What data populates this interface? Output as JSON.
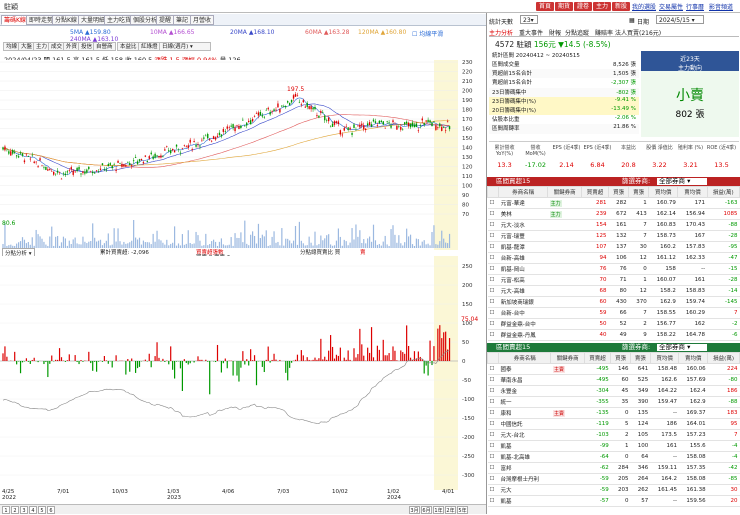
{
  "app": {
    "title": "駐穎"
  },
  "top_buttons": [
    "首頁",
    "期貨",
    "證卷",
    "主力",
    "新股"
  ],
  "top_links": [
    "我的選股",
    "交易屬性",
    "行事曆",
    "影音頻道"
  ],
  "tabs": [
    "籌碼K線",
    "即時走勢",
    "分點K線",
    "大量明細",
    "主力吃貨",
    "個股分析",
    "提醒",
    "筆記",
    "月營收"
  ],
  "subtabs": [
    "均線",
    "大盤",
    "主力",
    "成交",
    "外資",
    "投信",
    "自營商",
    "本益比",
    "紅綠燈",
    "日線(週月)"
  ],
  "ma_legend": [
    {
      "label": "5MA",
      "value": "159.80",
      "color": "#2a6bd6"
    },
    {
      "label": "10MA",
      "value": "166.65",
      "color": "#b34fd1"
    },
    {
      "label": "20MA",
      "value": "168.10",
      "color": "#3a49c9"
    },
    {
      "label": "60MA",
      "value": "163.28",
      "color": "#e05b5b"
    },
    {
      "label": "120MA",
      "value": "160.80",
      "color": "#e0a63a"
    },
    {
      "label": "240MA",
      "value": "163.10",
      "color": "#7a3bd6"
    }
  ],
  "ma_checkbox": "均線平滑",
  "quote_line": {
    "date": "2024/04/23",
    "items": [
      "開 161.5",
      "高 161.5",
      "低 158",
      "收 160.5"
    ],
    "change": "漲跌 1.5",
    "pct": "漲幅 0.94%",
    "volume": "量 126"
  },
  "price_axis": [
    "230",
    "220",
    "210",
    "200",
    "190",
    "180",
    "170",
    "160",
    "150",
    "140",
    "130",
    "120",
    "110",
    "100",
    "90",
    "80",
    "70"
  ],
  "price_marks": {
    "high": "197.5",
    "low": "80.6",
    "current": "156"
  },
  "vol_bar": {
    "label": "分點分析",
    "items": [
      "累計買賣超: -2,096",
      "買賣超張數",
      "分點總買賣比 買",
      "賣"
    ],
    "extra": "買賣 8  賣賣 6"
  },
  "osc_axis": [
    "250",
    "200",
    "150",
    "100",
    "50",
    "0",
    "-50",
    "-100",
    "-150",
    "-200",
    "-250",
    "-300"
  ],
  "osc_marker": "75.04",
  "x_axis": [
    {
      "label": "4/25",
      "sub": "2022"
    },
    {
      "label": "7/01",
      "sub": ""
    },
    {
      "label": "10/03",
      "sub": ""
    },
    {
      "label": "1/03",
      "sub": "2023"
    },
    {
      "label": "4/06",
      "sub": ""
    },
    {
      "label": "7/03",
      "sub": ""
    },
    {
      "label": "10/02",
      "sub": ""
    },
    {
      "label": "1/02",
      "sub": "2024"
    },
    {
      "label": "4/01",
      "sub": ""
    }
  ],
  "pager": [
    "1",
    "2",
    "3",
    "4",
    "5",
    "6"
  ],
  "range_buttons": [
    "3月",
    "6月",
    "1年",
    "2年",
    "5年"
  ],
  "right_header": {
    "days_label": "統計天數",
    "days_value": "23",
    "date_label": "日期",
    "date_value": "2024/5/15"
  },
  "right_tabs": [
    "主力分析",
    "重大事件",
    "財報",
    "分點追蹤",
    "賺賠率",
    "法人買賣(216元)"
  ],
  "stock": {
    "code": "4572 駐穎",
    "price": "156元",
    "change": "▼14.5",
    "pct": "(-8.5%)"
  },
  "period": {
    "label": "統計區間",
    "value": "20240412 ~ 20240515"
  },
  "stats": [
    {
      "label": "區間成交量",
      "value": "8,526 張"
    },
    {
      "label": "買超前15名合計",
      "value": "1,505 張"
    },
    {
      "label": "賣超前15名合計",
      "value": "-2,307 張"
    },
    {
      "label": "23日籌碼集中",
      "value": "-802 張"
    },
    {
      "label": "23日籌碼集中(%)",
      "value": "-9.41 %"
    },
    {
      "label": "20日籌碼集中(%)",
      "value": "-13.49 %"
    },
    {
      "label": "佔股本比重",
      "value": "-2.06 %"
    },
    {
      "label": "區間周轉率",
      "value": "21.86 %"
    }
  ],
  "main_force": {
    "title": "近23天",
    "subtitle": "主力動向",
    "verdict": "小賣",
    "amount": "802 張"
  },
  "metrics_head": [
    "累計營收 YoY(%)",
    "營收 MoM(%)",
    "EPS (近4季)",
    "EPS (近4季)",
    "本益比",
    "股價 淨值比",
    "殖利率 (%)",
    "ROE (近4季)"
  ],
  "metrics_vals": [
    "13.3",
    "-17.02",
    "2.14",
    "6.84",
    "20.8",
    "3.22",
    "3.21",
    "13.5"
  ],
  "buy_section": {
    "title": "區間買超15",
    "filter_label": "篩選券商:",
    "filter_value": "全部券商"
  },
  "buy_cols": [
    "券商名稱",
    "關鍵券商",
    "買賣超",
    "買張",
    "賣張",
    "買均價",
    "賣均價",
    "損益(萬)"
  ],
  "buy_rows": [
    [
      "元富-華達",
      "主力",
      "281",
      "282",
      "1",
      "160.79",
      "171",
      "-163"
    ],
    [
      "美林",
      "主力",
      "239",
      "672",
      "413",
      "162.14",
      "156.94",
      "1085"
    ],
    [
      "元大-淡水",
      "",
      "154",
      "161",
      "7",
      "160.83",
      "170.43",
      "-88"
    ],
    [
      "元富-瑞豐",
      "",
      "125",
      "132",
      "7",
      "158.73",
      "167",
      "-28"
    ],
    [
      "凱基-龍潭",
      "",
      "107",
      "137",
      "30",
      "160.2",
      "157.83",
      "-95"
    ],
    [
      "台新-高雄",
      "",
      "94",
      "106",
      "12",
      "161.12",
      "162.33",
      "-47"
    ],
    [
      "凱基-岡山",
      "",
      "76",
      "76",
      "0",
      "158",
      "--",
      "-15"
    ],
    [
      "元富-松高",
      "",
      "70",
      "71",
      "1",
      "160.07",
      "161",
      "-28"
    ],
    [
      "元大-高雄",
      "",
      "68",
      "80",
      "12",
      "158.2",
      "158.83",
      "-14"
    ],
    [
      "新加坡商瑞銀",
      "",
      "60",
      "430",
      "370",
      "162.9",
      "159.74",
      "-145"
    ],
    [
      "台新-台中",
      "",
      "59",
      "66",
      "7",
      "158.55",
      "160.29",
      "7"
    ],
    [
      "群益金鼎-台中",
      "",
      "50",
      "52",
      "2",
      "156.77",
      "162",
      "-2"
    ],
    [
      "群益金鼎-丹鳳",
      "",
      "40",
      "49",
      "9",
      "158.22",
      "164.78",
      "-6"
    ]
  ],
  "sell_section": {
    "title": "區間賣超15",
    "filter_label": "篩選券商:",
    "filter_value": "全部券商"
  },
  "sell_cols": [
    "券商名稱",
    "關鍵券商",
    "買賣超",
    "買張",
    "賣張",
    "買均價",
    "賣均價",
    "損益(萬)"
  ],
  "sell_rows": [
    [
      "國泰",
      "主賣",
      "-495",
      "146",
      "641",
      "158.48",
      "160.06",
      "224"
    ],
    [
      "華南永昌",
      "",
      "-495",
      "60",
      "525",
      "162.6",
      "157.69",
      "-80"
    ],
    [
      "永豐金",
      "",
      "-304",
      "45",
      "349",
      "164.22",
      "162.4",
      "186"
    ],
    [
      "統一",
      "",
      "-355",
      "35",
      "390",
      "159.47",
      "162.9",
      "-88"
    ],
    [
      "康和",
      "主賣",
      "-135",
      "0",
      "135",
      "--",
      "169.37",
      "183"
    ],
    [
      "中國信託",
      "",
      "-119",
      "5",
      "124",
      "186",
      "164.01",
      "95"
    ],
    [
      "元大-台北",
      "",
      "-103",
      "2",
      "105",
      "173.5",
      "157.23",
      "7"
    ],
    [
      "凱基",
      "",
      "-99",
      "1",
      "100",
      "161",
      "155.6",
      "-4"
    ],
    [
      "凱基-北高雄",
      "",
      "-64",
      "0",
      "64",
      "--",
      "158.08",
      "-4"
    ],
    [
      "富邦",
      "",
      "-62",
      "284",
      "346",
      "159.11",
      "157.35",
      "-42"
    ],
    [
      "台灣摩根士丹利",
      "",
      "-59",
      "205",
      "264",
      "164.2",
      "158.08",
      "-85"
    ],
    [
      "元大",
      "",
      "-59",
      "203",
      "262",
      "161.45",
      "161.38",
      "30"
    ],
    [
      "凱基",
      "",
      "-57",
      "0",
      "57",
      "--",
      "159.56",
      "20"
    ]
  ],
  "colors": {
    "up": "#d00000",
    "down": "#009900",
    "accent": "#2f5597",
    "highlight": "#fbf7d6"
  }
}
